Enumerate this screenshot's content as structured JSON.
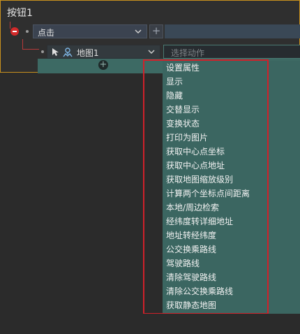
{
  "component": {
    "title": "按钮1"
  },
  "event": {
    "selected": "点击",
    "add_label": "+"
  },
  "action": {
    "target": "地图1",
    "placeholder": "选择动作",
    "add_label": "+"
  },
  "menu": {
    "items": [
      "设置属性",
      "显示",
      "隐藏",
      "交替显示",
      "变换状态",
      "打印为图片",
      "获取中心点坐标",
      "获取中心点地址",
      "获取地图缩放级别",
      "计算两个坐标点间距离",
      "本地/周边检索",
      "经纬度转详细地址",
      "地址转经纬度",
      "公交换乘路线",
      "驾驶路线",
      "清除驾驶路线",
      "清除公交换乘路线",
      "获取静态地图"
    ]
  },
  "colors": {
    "highlight": "#d0212a",
    "panel_border": "#c8911e",
    "dropdown_bg": "#3b6661"
  }
}
